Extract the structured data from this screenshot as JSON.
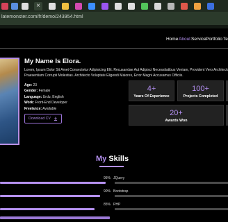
{
  "browser": {
    "tab_colors": [
      "#d6435a",
      "#5a8fe0",
      "#dfdfdf",
      "#dfdfdf",
      "#f0c040",
      "#d34ab0",
      "#3c8fff",
      "#9a55f0",
      "#dfdfdf",
      "#dfdfdf",
      "#52c45a",
      "#d9d9d9",
      "#b8b8b8",
      "#e0584a",
      "#f0a040",
      "#3c6fe0",
      "#cfcfcf"
    ],
    "close_glyph": "×",
    "url": "latemonster.com/fr/demo/243954.html"
  },
  "nav": {
    "items": [
      {
        "label": "Home",
        "active": false
      },
      {
        "label": "About",
        "active": true
      },
      {
        "label": "Service",
        "active": false
      },
      {
        "label": "Portfolio",
        "active": false
      },
      {
        "label": "Te",
        "active": false
      }
    ]
  },
  "hero": {
    "title": "My Name Is Elora.",
    "description": "Lorem, Ipsum Dolor Sit Amet Consectetur Adipisicing Elit. Recusandae Aut Adipisci Necessitatibus Veniam, Provident Vero Architecto Praesentium Corrupti Molestias. Architecto Voluptate Eligendi Maiores, Error Magni Accusamus Officiis.",
    "info": [
      {
        "key": "Age:",
        "value": "23"
      },
      {
        "key": "Gender:",
        "value": "Female"
      },
      {
        "key": "Language:",
        "value": "Urdu, English"
      },
      {
        "key": "Work:",
        "value": "Front-End Developer"
      },
      {
        "key": "Freelance:",
        "value": "Available"
      }
    ],
    "download_label": "Download CV"
  },
  "stats": [
    {
      "number": "4+",
      "label": "Years Of Experience"
    },
    {
      "number": "100+",
      "label": "Projects Completed"
    },
    {
      "number": "20+",
      "label": "Awards Won"
    }
  ],
  "skills": {
    "title_accent": "My",
    "title_rest": "Skills",
    "items": [
      {
        "percent": "95%",
        "name": "JQuery",
        "level": 0.95
      },
      {
        "percent": "90%",
        "name": "Bootstrap",
        "level": 0.9
      },
      {
        "percent": "85%",
        "name": "PHP",
        "level": 0.85
      }
    ]
  },
  "colors": {
    "accent": "#b490ef",
    "background": "#000000",
    "card": "#222222"
  }
}
